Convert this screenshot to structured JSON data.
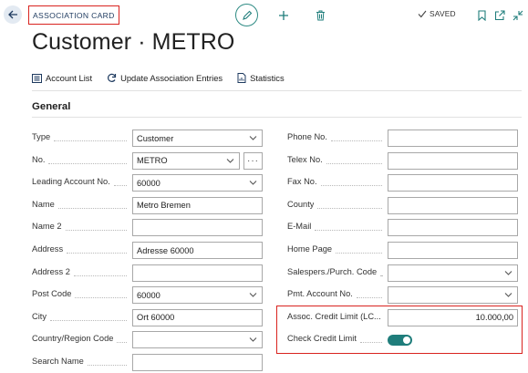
{
  "header": {
    "page_type": "ASSOCIATION CARD",
    "status": "SAVED",
    "title": "Customer · METRO"
  },
  "icons": {
    "back": "back-arrow-icon",
    "edit": "pencil-icon",
    "new": "plus-icon",
    "delete": "trash-icon",
    "saved": "checkmark-icon",
    "bookmark": "bookmark-icon",
    "open_new": "open-new-window-icon",
    "collapse": "collapse-icon"
  },
  "actions": [
    {
      "label": "Account List",
      "icon": "list-icon"
    },
    {
      "label": "Update Association Entries",
      "icon": "refresh-icon"
    },
    {
      "label": "Statistics",
      "icon": "document-chart-icon"
    }
  ],
  "section": {
    "title": "General"
  },
  "left_fields": [
    {
      "label": "Type",
      "value": "Customer",
      "kind": "select"
    },
    {
      "label": "No.",
      "value": "METRO",
      "kind": "select-more"
    },
    {
      "label": "Leading Account No.",
      "value": "60000",
      "kind": "select"
    },
    {
      "label": "Name",
      "value": "Metro Bremen",
      "kind": "text"
    },
    {
      "label": "Name 2",
      "value": "",
      "kind": "text"
    },
    {
      "label": "Address",
      "value": "Adresse 60000",
      "kind": "text"
    },
    {
      "label": "Address 2",
      "value": "",
      "kind": "text"
    },
    {
      "label": "Post Code",
      "value": "60000",
      "kind": "select"
    },
    {
      "label": "City",
      "value": "Ort 60000",
      "kind": "text"
    },
    {
      "label": "Country/Region Code",
      "value": "",
      "kind": "select"
    },
    {
      "label": "Search Name",
      "value": "",
      "kind": "text"
    }
  ],
  "right_fields": [
    {
      "label": "Phone No.",
      "value": "",
      "kind": "text"
    },
    {
      "label": "Telex No.",
      "value": "",
      "kind": "text"
    },
    {
      "label": "Fax No.",
      "value": "",
      "kind": "text"
    },
    {
      "label": "County",
      "value": "",
      "kind": "text"
    },
    {
      "label": "E-Mail",
      "value": "",
      "kind": "text"
    },
    {
      "label": "Home Page",
      "value": "",
      "kind": "text"
    },
    {
      "label": "Salespers./Purch. Code",
      "value": "",
      "kind": "select"
    },
    {
      "label": "Pmt. Account No.",
      "value": "",
      "kind": "select"
    },
    {
      "label": "Assoc. Credit Limit (LC...",
      "value": "10.000,00",
      "kind": "number"
    },
    {
      "label": "Check Credit Limit",
      "value": "on",
      "kind": "toggle"
    }
  ],
  "colors": {
    "accent": "#1f7d7b",
    "highlight": "#d9231f"
  }
}
